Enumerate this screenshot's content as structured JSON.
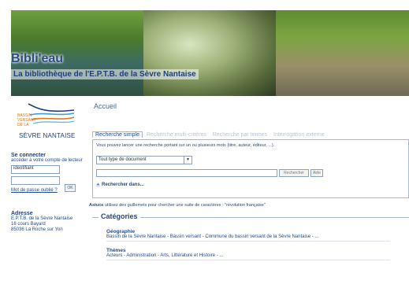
{
  "banner": {
    "title": "Bibli'eau",
    "subtitle": "La bibliothèque de l'E.P.T.B. de la Sèvre Nantaise"
  },
  "sidebar": {
    "logo": {
      "small_text": [
        "BASSIN",
        "VERSANT",
        "DE LA"
      ],
      "big_text": "SÈVRE NANTAISE"
    },
    "login": {
      "title": "Se connecter",
      "description": "accéder à votre compte de lecteur",
      "id_value": "identifiant",
      "ok_label": "OK",
      "forgot_link": "Mot de passe oublié ?"
    },
    "address": {
      "title": "Adresse",
      "line1": "E.P.T.B. de la Sèvre Nantaise",
      "line2": "16 cours Bayard",
      "line3": "85036 La Roche sur Yon"
    }
  },
  "main": {
    "breadcrumb": "Accueil",
    "tabs": [
      "Recherche simple",
      "Recherche multi-critères",
      "Recherche par termes",
      "Interrogation externe"
    ],
    "search": {
      "help": "Vous pouvez lancer une recherche portant sur un ou plusieurs mots (titre, auteur, éditeur, ...).",
      "select_value": "Tout type de document",
      "button_search": "Rechercher",
      "button_help": "Aide",
      "search_in": "Rechercher dans..."
    },
    "tip": {
      "bold": "Astuce",
      "text": " utilisez des guillemets pour chercher une suite de caractères : \"révolution française\""
    },
    "categories": {
      "title": "Catégories",
      "items": [
        {
          "title": "Géographie",
          "text": "Bassin de la Sèvre Nantaise - Bassin versant - Commune du bassin versant de la Sèvre Nantaise - ..."
        },
        {
          "title": "Thèmes",
          "text": "Acteurs - Administration - Arts, Littérature et Histoire - ..."
        }
      ]
    }
  },
  "colors": {
    "primary": "#1f4a8a",
    "accent": "#e07a1f",
    "border": "#aab8cc"
  }
}
